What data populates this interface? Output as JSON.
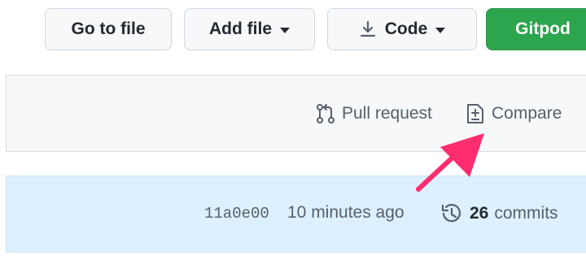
{
  "toolbar": {
    "go_to_file": "Go to file",
    "add_file": "Add file",
    "code": "Code",
    "gitpod": "Gitpod"
  },
  "compare_bar": {
    "pull_request": "Pull request",
    "compare": "Compare"
  },
  "latest_commit": {
    "hash": "11a0e00",
    "time": "10 minutes ago",
    "commit_count": "26",
    "commits_label": "commits"
  },
  "icons": {
    "add_file_caret": "caret-down-icon",
    "code_download": "download-icon",
    "code_caret": "caret-down-icon",
    "pull_request": "git-pull-request-icon",
    "compare": "file-diff-icon",
    "history": "history-icon",
    "annotation": "arrow-annotation"
  },
  "colors": {
    "gitpod_button": "#2da44e",
    "compare_bar_bg": "#f6f8fa",
    "commit_bar_bg": "#ddf0ff",
    "annotation_arrow": "#ff2d6f"
  }
}
